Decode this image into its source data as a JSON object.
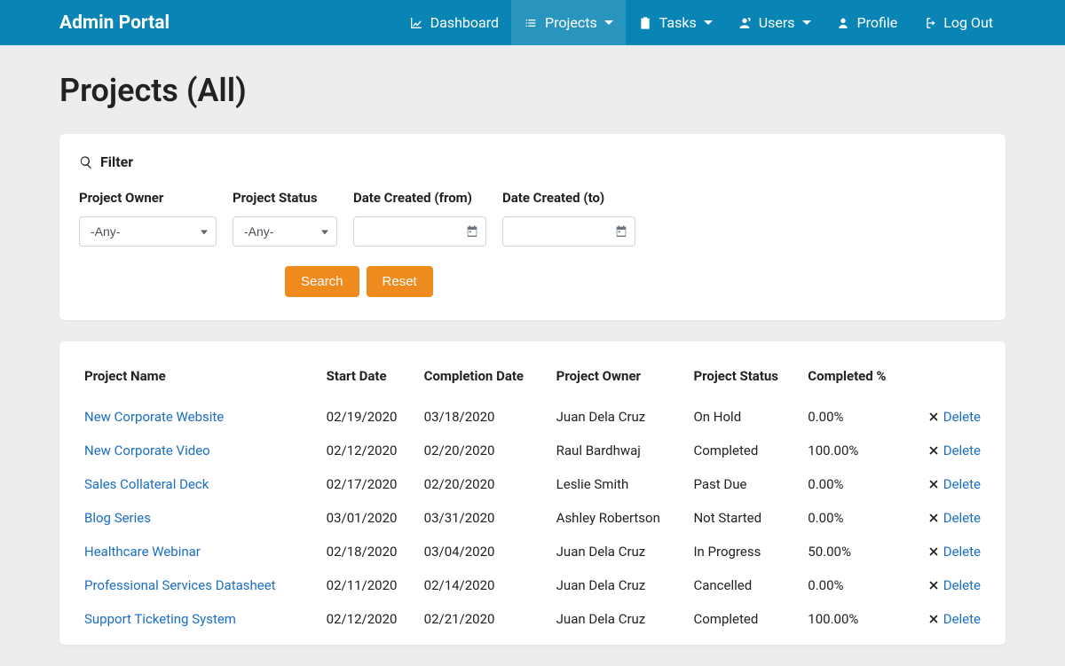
{
  "brand": "Admin Portal",
  "nav": {
    "dashboard": "Dashboard",
    "projects": "Projects",
    "tasks": "Tasks",
    "users": "Users",
    "profile": "Profile",
    "logout": "Log Out"
  },
  "page": {
    "title": "Projects (All)"
  },
  "filter": {
    "header": "Filter",
    "owner_label": "Project Owner",
    "status_label": "Project Status",
    "date_from_label": "Date Created (from)",
    "date_to_label": "Date Created (to)",
    "any_option": "-Any-",
    "search_btn": "Search",
    "reset_btn": "Reset"
  },
  "table": {
    "headers": {
      "name": "Project Name",
      "start": "Start Date",
      "completion": "Completion Date",
      "owner": "Project Owner",
      "status": "Project Status",
      "completed": "Completed %"
    },
    "delete_label": "Delete",
    "rows": [
      {
        "name": "New Corporate Website",
        "start": "02/19/2020",
        "completion": "03/18/2020",
        "owner": "Juan Dela Cruz",
        "status": "On Hold",
        "completed": "0.00%"
      },
      {
        "name": "New Corporate Video",
        "start": "02/12/2020",
        "completion": "02/20/2020",
        "owner": "Raul Bardhwaj",
        "status": "Completed",
        "completed": "100.00%"
      },
      {
        "name": "Sales Collateral Deck",
        "start": "02/17/2020",
        "completion": "02/20/2020",
        "owner": "Leslie Smith",
        "status": "Past Due",
        "completed": "0.00%"
      },
      {
        "name": "Blog Series",
        "start": "03/01/2020",
        "completion": "03/31/2020",
        "owner": "Ashley Robertson",
        "status": "Not Started",
        "completed": "0.00%"
      },
      {
        "name": "Healthcare Webinar",
        "start": "02/18/2020",
        "completion": "03/04/2020",
        "owner": "Juan Dela Cruz",
        "status": "In Progress",
        "completed": "50.00%"
      },
      {
        "name": "Professional Services Datasheet",
        "start": "02/11/2020",
        "completion": "02/14/2020",
        "owner": "Juan Dela Cruz",
        "status": "Cancelled",
        "completed": "0.00%"
      },
      {
        "name": "Support Ticketing System",
        "start": "02/12/2020",
        "completion": "02/21/2020",
        "owner": "Juan Dela Cruz",
        "status": "Completed",
        "completed": "100.00%"
      }
    ]
  }
}
